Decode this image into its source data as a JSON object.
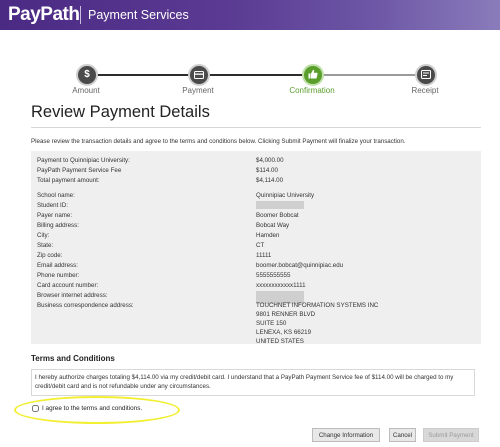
{
  "header": {
    "logo": "PayPath",
    "title": "Payment Services"
  },
  "steps": [
    {
      "label": "Amount",
      "icon": "dollar-icon",
      "active": false
    },
    {
      "label": "Payment",
      "icon": "card-icon",
      "active": false
    },
    {
      "label": "Confirmation",
      "icon": "thumbs-up-icon",
      "active": true
    },
    {
      "label": "Receipt",
      "icon": "receipt-icon",
      "active": false
    }
  ],
  "page_title": "Review Payment Details",
  "intro": "Please review the transaction details and agree to the terms and conditions below. Clicking Submit Payment will finalize your transaction.",
  "summary": [
    {
      "label": "Payment to Quinnipiac University:",
      "value": "$4,000.00"
    },
    {
      "label": "PayPath Payment Service Fee",
      "value": "$114.00"
    },
    {
      "label": "Total payment amount:",
      "value": "$4,114.00"
    }
  ],
  "details": [
    {
      "label": "School name:",
      "value": "Quinnipiac University"
    },
    {
      "label": "Student ID:",
      "value": ""
    },
    {
      "label": "Payer name:",
      "value": "Boomer Bobcat"
    },
    {
      "label": "Billing address:",
      "value": "Bobcat Way"
    },
    {
      "label": "City:",
      "value": "Hamden"
    },
    {
      "label": "State:",
      "value": "CT"
    },
    {
      "label": "Zip code:",
      "value": "11111"
    },
    {
      "label": "Email address:",
      "value": "boomer.bobcat@quinnipiac.edu"
    },
    {
      "label": "Phone number:",
      "value": "5555555555"
    },
    {
      "label": "Card account number:",
      "value": "xxxxxxxxxxxx1111"
    },
    {
      "label": "Browser internet address:",
      "value": ""
    },
    {
      "label": "Business correspondence address:",
      "value": ""
    }
  ],
  "business_address": [
    "TOUCHNET INFORMATION SYSTEMS INC",
    "9801 RENNER BLVD",
    "SUITE 150",
    "LENEXA, KS 66219",
    "UNITED STATES"
  ],
  "terms": {
    "title": "Terms and Conditions",
    "text": "I hereby authorize charges totaling $4,114.00 via my credit/debit card. I understand that a PayPath Payment Service fee of $114.00 will be charged to my credit/debit card and is not refundable under any circumstances.",
    "agree_label": "I agree to the terms and conditions."
  },
  "buttons": {
    "change": "Change Information",
    "cancel": "Cancel",
    "submit": "Submit Payment"
  },
  "colors": {
    "header": "#4b2a83",
    "active_step": "#5a9e2c",
    "highlight": "#f2ee30"
  }
}
